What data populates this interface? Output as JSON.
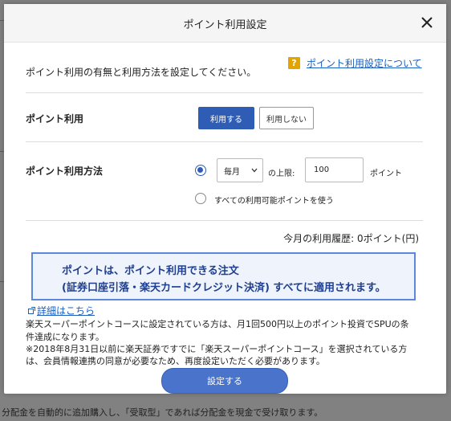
{
  "background": {
    "snippet": "分配金を自動的に追加購入し、「受取型」であれば分配金を現金で受け取ります。"
  },
  "modal": {
    "title": "ポイント利用設定",
    "intro": "ポイント利用の有無と利用方法を設定してください。",
    "help": {
      "icon": "?",
      "link": "ポイント利用設定について"
    },
    "point_use": {
      "label": "ポイント利用",
      "on_label": "利用する",
      "off_label": "利用しない",
      "selected": "利用する"
    },
    "method": {
      "label": "ポイント利用方法",
      "frequency": "毎月",
      "limit_label": "の上限:",
      "limit_value": "100",
      "unit": "ポイント",
      "all_label": "すべての利用可能ポイントを使う",
      "selected_option": "limit"
    },
    "history": "今月の利用履歴: 0ポイント(円)",
    "notice": {
      "line1": "ポイントは、ポイント利用できる注文",
      "line2": "(証券口座引落・楽天カードクレジット決済) すべてに適用されます。"
    },
    "detail_link": "詳細はこちら",
    "notes": [
      "楽天スーパーポイントコースに設定されている方は、月1回500円以上のポイント投資でSPUの条",
      "件達成になります。",
      "※2018年8月31日以前に楽天証券ですでに「楽天スーパーポイントコース」を選択されている方",
      "は、会員情報連携の同意が必要なため、再度設定いただく必要があります。"
    ],
    "submit": "設定する"
  },
  "colors": {
    "primary": "#2f5db5",
    "notice_border": "#5b88d8",
    "notice_bg": "#eef3fc",
    "help_icon": "#e4a400",
    "link": "#1a5fc0"
  }
}
